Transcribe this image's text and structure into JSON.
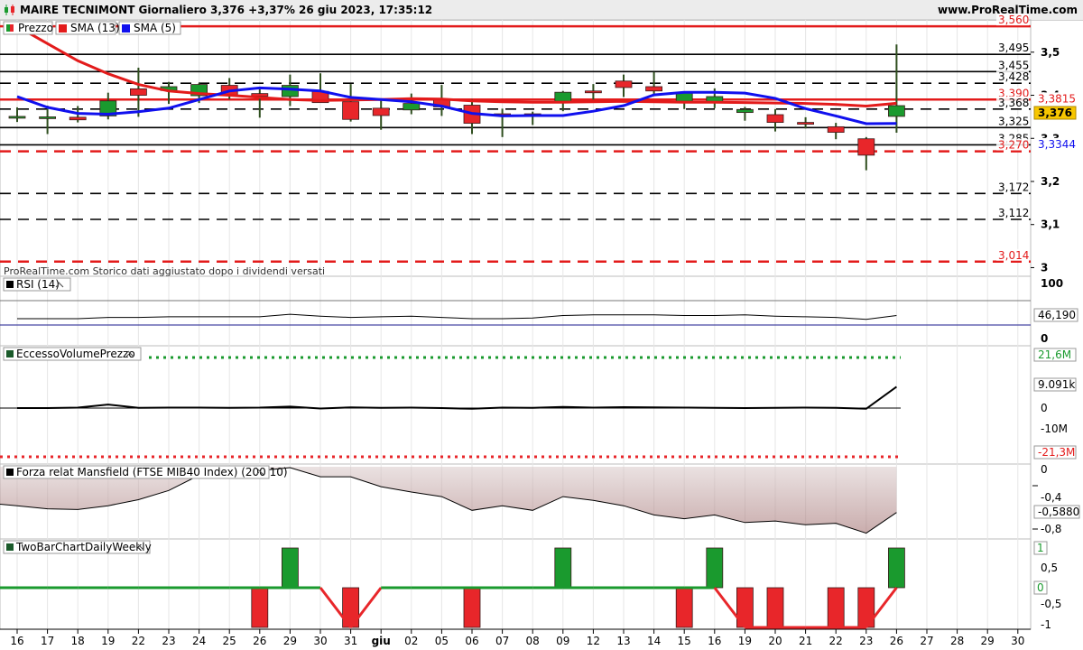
{
  "header": {
    "title": "MAIRE TECNIMONT Giornaliero 3,376 +3,37% 26 giu 2023, 17:35:12",
    "site": "www.ProRealTime.com"
  },
  "colors": {
    "up": "#1a9a2e",
    "down": "#e8262a",
    "sma13": "#e31b1b",
    "sma5": "#1010ee",
    "price_tag": "#f7c600",
    "grid": "#e6e6e6",
    "rsi_line": "#1a1a8c"
  },
  "panels": {
    "price": {
      "legend": [
        {
          "label": "Prezzo",
          "icon": "candle-icon"
        },
        {
          "label": "SMA (13)",
          "icon": "red-square-icon"
        },
        {
          "label": "SMA (5)",
          "icon": "blue-square-icon"
        }
      ],
      "note": "ProRealTime.com Storico dati aggiustato dopo i dividendi versati",
      "axis_ticks": [
        "3,5",
        "3,4",
        "3,3",
        "3,2",
        "3,1",
        "3"
      ],
      "levels": [
        {
          "label": "3,560",
          "value": 3.56,
          "style": "solid-red",
          "text_color": "#e31b1b"
        },
        {
          "label": "3,495",
          "value": 3.495,
          "style": "solid-black",
          "text_color": "#000000"
        },
        {
          "label": "3,455",
          "value": 3.455,
          "style": "solid-black",
          "text_color": "#000000"
        },
        {
          "label": "3,428",
          "value": 3.428,
          "style": "dash-black",
          "text_color": "#000000"
        },
        {
          "label": "3,390",
          "value": 3.39,
          "style": "solid-red",
          "text_color": "#e31b1b"
        },
        {
          "label": "3,368",
          "value": 3.368,
          "style": "dash-black",
          "text_color": "#000000"
        },
        {
          "label": "3,325",
          "value": 3.325,
          "style": "solid-black",
          "text_color": "#000000"
        },
        {
          "label": "3,285",
          "value": 3.285,
          "style": "solid-black",
          "text_color": "#000000"
        },
        {
          "label": "3,270",
          "value": 3.27,
          "style": "dash-red",
          "text_color": "#e31b1b"
        },
        {
          "label": "3,172",
          "value": 3.172,
          "style": "dash-black",
          "text_color": "#000000"
        },
        {
          "label": "3,112",
          "value": 3.112,
          "style": "dash-black",
          "text_color": "#000000"
        },
        {
          "label": "3,014",
          "value": 3.014,
          "style": "dash-red",
          "text_color": "#e31b1b"
        }
      ],
      "tags": [
        {
          "label": "3,3815",
          "value": 3.3815,
          "color": "#e31b1b",
          "bold": false,
          "bg": "#ffffff"
        },
        {
          "label": "3,376",
          "value": 3.376,
          "color": "#000000",
          "bold": true,
          "bg": "#f7c600"
        },
        {
          "label": "3,3344",
          "value": 3.3344,
          "color": "#1010ee",
          "bold": false,
          "bg": "#ffffff"
        }
      ]
    },
    "rsi": {
      "label": "RSI (14)",
      "axis_ticks": [
        "100",
        "0"
      ],
      "tag": "46,190"
    },
    "volume": {
      "label": "EccessoVolumePrezzo",
      "axis_ticks": [
        "0",
        "-10M"
      ],
      "tags": [
        {
          "label": "21,6M",
          "value": 21.6,
          "color": "#1a9a2e"
        },
        {
          "label": "9.091k",
          "value": 9.091,
          "color": "#000000"
        },
        {
          "label": "-21,3M",
          "value": -21.3,
          "color": "#e31b1b"
        }
      ]
    },
    "mansfield": {
      "label": "Forza relat Mansfield (FTSE MIB40 Index) (200 10)",
      "axis_ticks": [
        "0",
        "-0,4",
        "-0,8"
      ],
      "hidden_ticks": [
        "-0,2",
        "-0,6"
      ],
      "tag": "-0,5880"
    },
    "twobar": {
      "label": "TwoBarChartDailyWeekly",
      "axis_ticks": [
        "0,5",
        "-0,5",
        "-1"
      ],
      "tags": [
        "1",
        "0"
      ]
    }
  },
  "x_axis": {
    "labels": [
      "16",
      "17",
      "18",
      "19",
      "22",
      "23",
      "24",
      "25",
      "26",
      "29",
      "30",
      "31",
      "giu",
      "02",
      "05",
      "06",
      "07",
      "08",
      "09",
      "12",
      "13",
      "14",
      "15",
      "16",
      "19",
      "20",
      "21",
      "22",
      "23",
      "26",
      "27",
      "28",
      "29",
      "30"
    ],
    "bold_index": 12
  },
  "chart_data": [
    {
      "type": "candlestick",
      "title": "MAIRE TECNIMONT Giornaliero",
      "ylim": [
        3.0,
        3.56
      ],
      "x": [
        "16",
        "17",
        "18",
        "19",
        "22",
        "23",
        "24",
        "25",
        "26",
        "29",
        "30",
        "31",
        "giu",
        "02",
        "05",
        "06",
        "07",
        "08",
        "09",
        "12",
        "13",
        "14",
        "15",
        "16",
        "19",
        "20",
        "21",
        "22",
        "23",
        "26"
      ],
      "open": [
        3.351,
        3.35,
        3.349,
        3.352,
        3.415,
        3.411,
        3.399,
        3.423,
        3.404,
        3.397,
        3.409,
        3.385,
        3.37,
        3.366,
        3.39,
        3.377,
        3.357,
        3.357,
        3.386,
        3.41,
        3.433,
        3.42,
        3.386,
        3.383,
        3.36,
        3.355,
        3.337,
        3.327,
        3.299,
        3.351
      ],
      "high": [
        3.372,
        3.376,
        3.375,
        3.406,
        3.464,
        3.431,
        3.428,
        3.44,
        3.42,
        3.448,
        3.451,
        3.426,
        3.388,
        3.404,
        3.424,
        3.391,
        3.369,
        3.362,
        3.41,
        3.426,
        3.448,
        3.454,
        3.407,
        3.416,
        3.373,
        3.368,
        3.349,
        3.336,
        3.303,
        3.518
      ],
      "low": [
        3.338,
        3.31,
        3.337,
        3.344,
        3.35,
        3.38,
        3.382,
        3.391,
        3.348,
        3.375,
        3.392,
        3.339,
        3.32,
        3.356,
        3.352,
        3.31,
        3.303,
        3.331,
        3.363,
        3.39,
        3.396,
        3.402,
        3.368,
        3.37,
        3.341,
        3.316,
        3.323,
        3.298,
        3.226,
        3.313
      ],
      "close": [
        3.351,
        3.35,
        3.343,
        3.387,
        3.4,
        3.42,
        3.425,
        3.4,
        3.398,
        3.423,
        3.383,
        3.344,
        3.353,
        3.381,
        3.373,
        3.335,
        3.355,
        3.351,
        3.407,
        3.406,
        3.418,
        3.41,
        3.405,
        3.397,
        3.367,
        3.337,
        3.333,
        3.314,
        3.261,
        3.376
      ],
      "series": [
        {
          "name": "SMA (13)",
          "values": [
            3.56,
            3.52,
            3.48,
            3.45,
            3.425,
            3.41,
            3.404,
            3.4,
            3.395,
            3.39,
            3.388,
            3.389,
            3.39,
            3.392,
            3.391,
            3.387,
            3.385,
            3.384,
            3.384,
            3.385,
            3.386,
            3.385,
            3.384,
            3.384,
            3.383,
            3.382,
            3.381,
            3.379,
            3.375,
            3.3815
          ]
        },
        {
          "name": "SMA (5)",
          "values": [
            3.397,
            3.372,
            3.358,
            3.356,
            3.362,
            3.37,
            3.39,
            3.41,
            3.417,
            3.414,
            3.41,
            3.395,
            3.39,
            3.385,
            3.375,
            3.358,
            3.352,
            3.353,
            3.353,
            3.363,
            3.376,
            3.401,
            3.407,
            3.407,
            3.405,
            3.393,
            3.369,
            3.352,
            3.334,
            3.3344
          ]
        }
      ]
    },
    {
      "type": "line",
      "title": "RSI (14)",
      "ylim": [
        0,
        100
      ],
      "values": [
        50,
        50,
        50,
        52,
        52,
        53,
        53,
        53,
        53,
        57,
        54,
        52,
        53,
        54,
        52,
        50,
        50,
        51,
        55,
        56,
        56,
        56,
        55,
        55,
        56,
        54,
        53,
        52,
        49,
        55
      ]
    },
    {
      "type": "line",
      "title": "EccessoVolumePrezzo",
      "ylim": [
        -21.3,
        21.6
      ],
      "values": [
        0,
        0,
        0.2,
        1.5,
        0.1,
        0.2,
        0.2,
        0.1,
        0.2,
        0.6,
        -0.2,
        0.3,
        0.1,
        0.2,
        0,
        -0.3,
        0.2,
        0.1,
        0.5,
        0.2,
        0.4,
        0.3,
        0.2,
        0.1,
        0,
        0.1,
        0.2,
        0.1,
        -0.3,
        9.091
      ]
    },
    {
      "type": "area",
      "title": "Forza relat Mansfield (FTSE MIB40 Index) (200 10)",
      "ylim": [
        -0.9,
        0
      ],
      "values": [
        -0.5,
        -0.54,
        -0.55,
        -0.5,
        -0.42,
        -0.3,
        -0.1,
        0.03,
        -0.04,
        0.05,
        -0.12,
        -0.12,
        -0.25,
        -0.32,
        -0.38,
        -0.56,
        -0.5,
        -0.56,
        -0.38,
        -0.43,
        -0.5,
        -0.62,
        -0.67,
        -0.62,
        -0.72,
        -0.7,
        -0.75,
        -0.73,
        -0.86,
        -0.588
      ]
    },
    {
      "type": "bar",
      "title": "TwoBarChartDailyWeekly",
      "ylim": [
        -1.1,
        1.1
      ],
      "values": [
        0,
        0,
        0,
        0,
        0,
        0,
        0,
        0,
        -1,
        1,
        0,
        -1,
        0,
        0,
        0,
        -1,
        0,
        0,
        1,
        0,
        0,
        0,
        -1,
        1,
        -1,
        -1,
        0,
        -1,
        -1,
        1
      ],
      "series": [
        {
          "values": [
            0,
            0,
            0,
            0,
            0,
            0,
            0,
            0,
            0,
            0,
            0,
            -1,
            0,
            0,
            0,
            0,
            0,
            0,
            0,
            0,
            0,
            0,
            0,
            0,
            -1,
            -1,
            -1,
            -1,
            -1,
            0
          ]
        }
      ]
    }
  ]
}
